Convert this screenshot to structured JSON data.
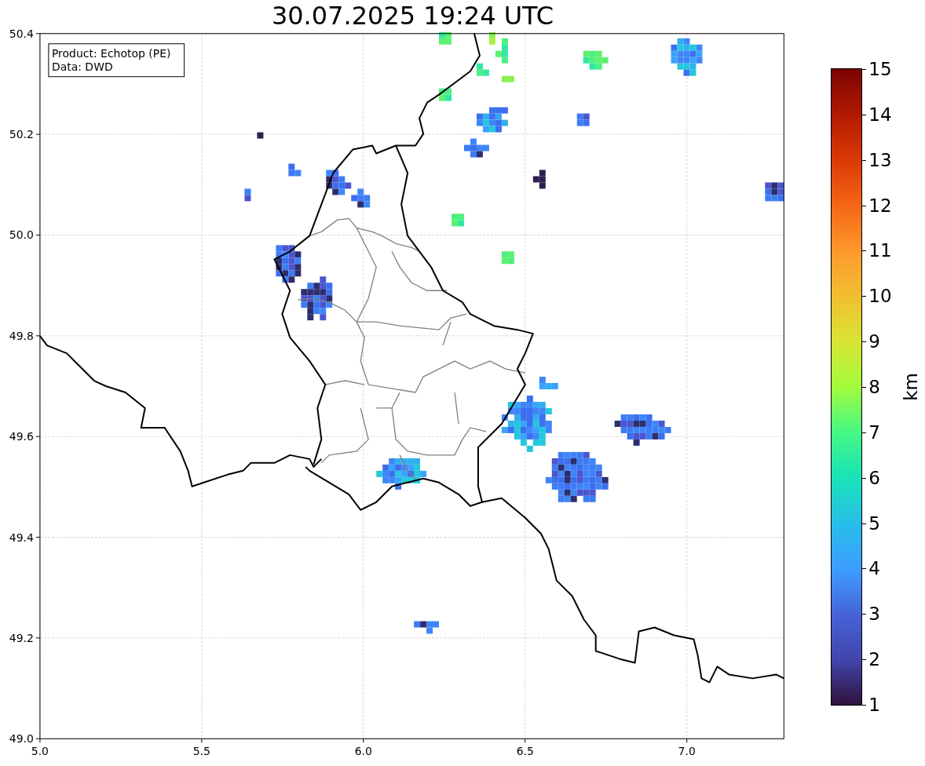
{
  "title": "30.07.2025 19:24 UTC",
  "info_box": [
    "Product: Echotop (PE)",
    "Data: DWD"
  ],
  "x_ticks": [
    "5.0",
    "5.5",
    "6.0",
    "6.5",
    "7.0"
  ],
  "y_ticks": [
    "50.4",
    "50.2",
    "50.0",
    "49.8",
    "49.6",
    "49.4",
    "49.2",
    "49.0"
  ],
  "colorbar": {
    "label": "km",
    "ticks": [
      "15",
      "14",
      "13",
      "12",
      "11",
      "10",
      "9",
      "8",
      "7",
      "6",
      "5",
      "4",
      "3",
      "2",
      "1"
    ]
  }
}
